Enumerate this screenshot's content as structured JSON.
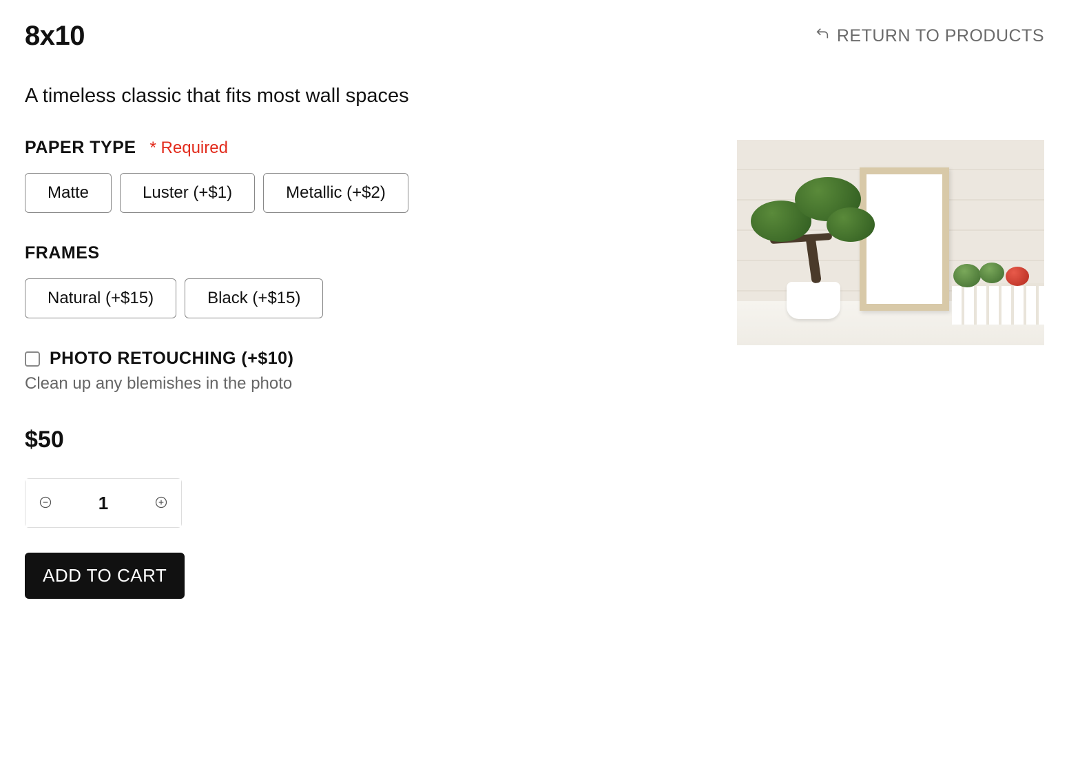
{
  "header": {
    "title": "8x10",
    "return_label": "RETURN TO PRODUCTS"
  },
  "description": "A timeless classic that fits most wall spaces",
  "paper_type": {
    "title": "PAPER TYPE",
    "required_label": "* Required",
    "options": [
      "Matte",
      "Luster (+$1)",
      "Metallic (+$2)"
    ]
  },
  "frames": {
    "title": "FRAMES",
    "options": [
      "Natural (+$15)",
      "Black (+$15)"
    ]
  },
  "addon": {
    "label": "PHOTO RETOUCHING (+$10)",
    "description": "Clean up any blemishes in the photo",
    "checked": false
  },
  "price": "$50",
  "quantity": {
    "value": "1"
  },
  "cart": {
    "add_label": "ADD TO CART"
  }
}
